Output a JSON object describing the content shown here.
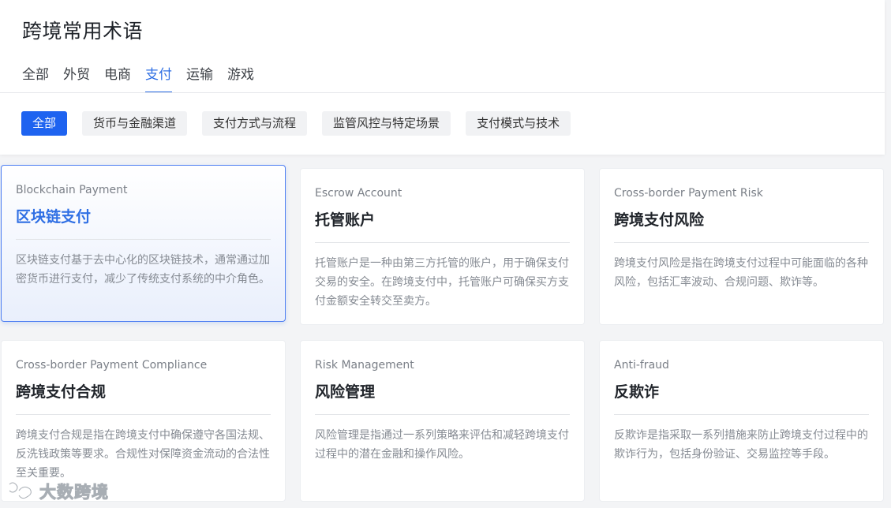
{
  "header": {
    "title": "跨境常用术语",
    "tabs": [
      {
        "label": "全部"
      },
      {
        "label": "外贸"
      },
      {
        "label": "电商"
      },
      {
        "label": "支付",
        "active": true
      },
      {
        "label": "运输"
      },
      {
        "label": "游戏"
      }
    ]
  },
  "filters": [
    {
      "label": "全部",
      "active": true
    },
    {
      "label": "货币与金融渠道"
    },
    {
      "label": "支付方式与流程"
    },
    {
      "label": "监管风控与特定场景"
    },
    {
      "label": "支付模式与技术"
    }
  ],
  "cards": [
    {
      "en": "Blockchain Payment",
      "zh": "区块链支付",
      "desc": "区块链支付基于去中心化的区块链技术，通常通过加密货币进行支付，减少了传统支付系统的中介角色。",
      "selected": true
    },
    {
      "en": "Escrow Account",
      "zh": "托管账户",
      "desc": "托管账户是一种由第三方托管的账户，用于确保支付交易的安全。在跨境支付中，托管账户可确保买方支付金额安全转交至卖方。"
    },
    {
      "en": "Cross-border Payment Risk",
      "zh": "跨境支付风险",
      "desc": "跨境支付风险是指在跨境支付过程中可能面临的各种风险，包括汇率波动、合规问题、欺诈等。"
    },
    {
      "en": "Cross-border Payment Compliance",
      "zh": "跨境支付合规",
      "desc": "跨境支付合规是指在跨境支付中确保遵守各国法规、反洗钱政策等要求。合规性对保障资金流动的合法性至关重要。"
    },
    {
      "en": "Risk Management",
      "zh": "风险管理",
      "desc": "风险管理是指通过一系列策略来评估和减轻跨境支付过程中的潜在金融和操作风险。"
    },
    {
      "en": "Anti-fraud",
      "zh": "反欺诈",
      "desc": "反欺诈是指采取一系列措施来防止跨境支付过程中的欺诈行为，包括身份验证、交易监控等手段。"
    }
  ],
  "watermark": {
    "text": "大数跨境",
    "icon": "logo-icon"
  },
  "colors": {
    "accent": "#2f6fe4",
    "active_chip": "#1e63f0"
  }
}
